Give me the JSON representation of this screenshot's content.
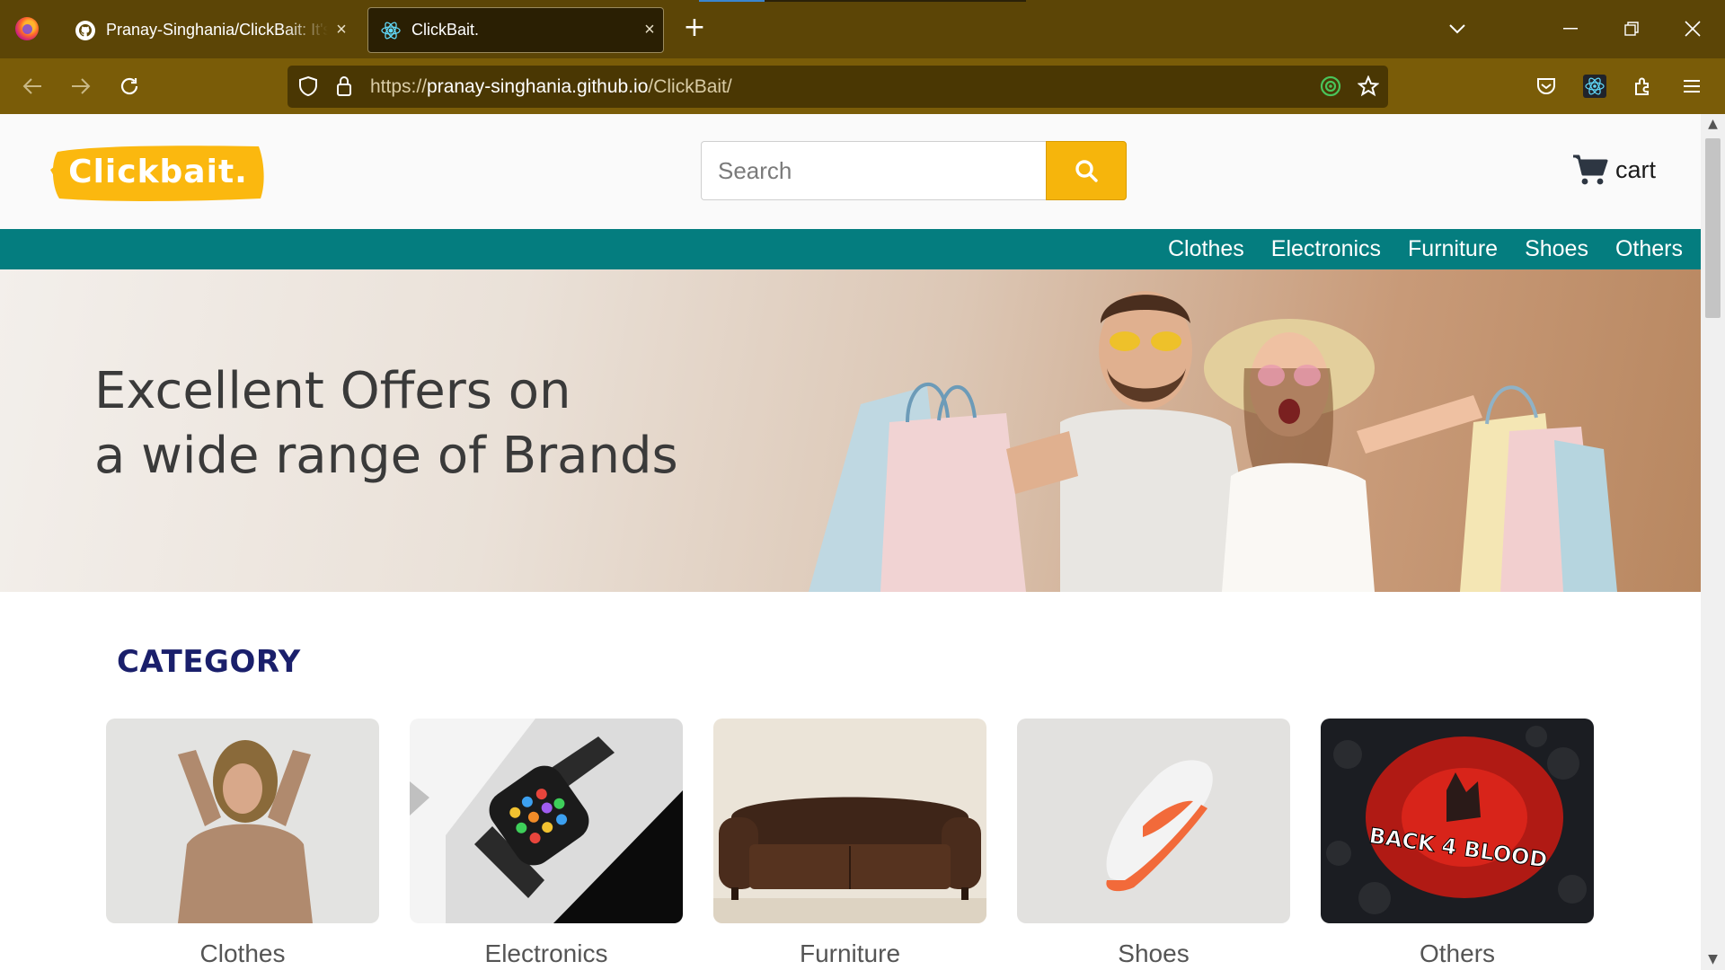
{
  "browser": {
    "tabs": [
      {
        "title": "Pranay-Singhania/ClickBait: It's a",
        "active": false,
        "icon": "github-icon"
      },
      {
        "title": "ClickBait.",
        "active": true,
        "icon": "react-icon"
      }
    ],
    "new_tab": "+",
    "close": "×",
    "url": {
      "scheme": "https://",
      "host": "pranay-singhania.github.io",
      "path": "/ClickBait/"
    }
  },
  "site": {
    "logo": "Clickbait.",
    "search": {
      "placeholder": "Search",
      "value": ""
    },
    "cart_label": "cart",
    "nav": [
      "Clothes",
      "Electronics",
      "Furniture",
      "Shoes",
      "Others"
    ],
    "banner": {
      "line1": "Excellent Offers on",
      "line2": "a wide range of Brands"
    },
    "category_title": "CATEGORY",
    "categories": [
      {
        "label": "Clothes",
        "icon": "clothes-image"
      },
      {
        "label": "Electronics",
        "icon": "smartwatch-image"
      },
      {
        "label": "Furniture",
        "icon": "sofa-image"
      },
      {
        "label": "Shoes",
        "icon": "sneaker-image"
      },
      {
        "label": "Others",
        "icon": "game-cover-image"
      }
    ],
    "colors": {
      "accent": "#f6b50c",
      "nav": "#047d7f",
      "title": "#1a1f6b",
      "chrome": "#7a5c08"
    }
  }
}
